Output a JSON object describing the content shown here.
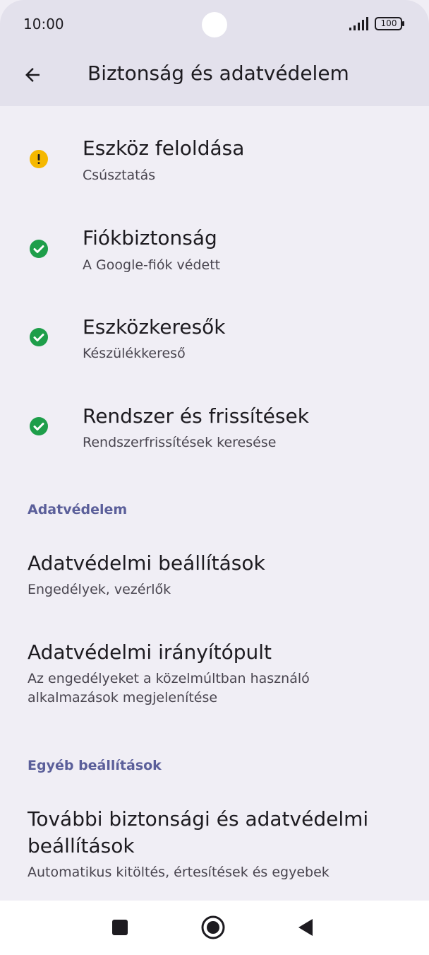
{
  "status_bar": {
    "time": "10:00",
    "battery": "100"
  },
  "app_bar": {
    "title": "Biztonság és adatvédelem"
  },
  "security_items": [
    {
      "title": "Eszköz feloldása",
      "subtitle": "Csúsztatás",
      "status": "warning",
      "status_color": "#f5b800"
    },
    {
      "title": "Fiókbiztonság",
      "subtitle": "A Google-fiók védett",
      "status": "ok",
      "status_color": "#1e9e4a"
    },
    {
      "title": "Eszközkeresők",
      "subtitle": "Készülékkereső",
      "status": "ok",
      "status_color": "#1e9e4a"
    },
    {
      "title": "Rendszer és frissítések",
      "subtitle": "Rendszerfrissítések keresése",
      "status": "ok",
      "status_color": "#1e9e4a"
    }
  ],
  "privacy_section": {
    "header": "Adatvédelem",
    "items": [
      {
        "title": "Adatvédelmi beállítások",
        "subtitle": "Engedélyek, vezérlők"
      },
      {
        "title": "Adatvédelmi irányítópult",
        "subtitle_line1": "Az engedélyeket a közelmúltban használó",
        "subtitle_line2": "alkalmazások megjelenítése"
      }
    ]
  },
  "other_section": {
    "header": "Egyéb beállítások",
    "items": [
      {
        "title_line1": "További biztonsági és adatvédelmi",
        "title_line2": "beállítások",
        "subtitle": "Automatikus kitöltés, értesítések és egyebek"
      }
    ]
  },
  "nav_bar": {
    "icons": [
      "recents-square-icon",
      "home-circle-icon",
      "back-triangle-icon"
    ]
  },
  "colors": {
    "app_bar_bg": "#e3e1ec",
    "page_bg": "#f0eef5",
    "accent": "#5b5f9a"
  }
}
